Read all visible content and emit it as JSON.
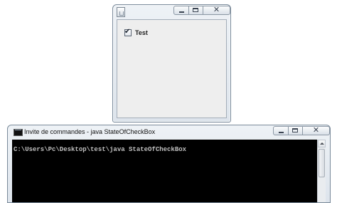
{
  "swing_window": {
    "title": "",
    "icon": "java-app-icon",
    "controls": {
      "minimize": "minimize-icon",
      "maximize": "maximize-icon",
      "close_label": "✕"
    },
    "checkbox": {
      "label": "Test",
      "checked": true,
      "checkmark": "✔"
    }
  },
  "console_window": {
    "title": "Invite de commandes - java  StateOfCheckBox",
    "icon": "cmd-icon",
    "controls": {
      "minimize": "minimize-icon",
      "maximize": "maximize-icon",
      "close_label": "✕"
    },
    "lines": [
      "C:\\Users\\Pc\\Desktop\\test\\java StateOfCheckBox"
    ]
  },
  "colors": {
    "console_background": "#000000",
    "console_text": "#c0c0c0",
    "client_background": "#eeeeee"
  }
}
